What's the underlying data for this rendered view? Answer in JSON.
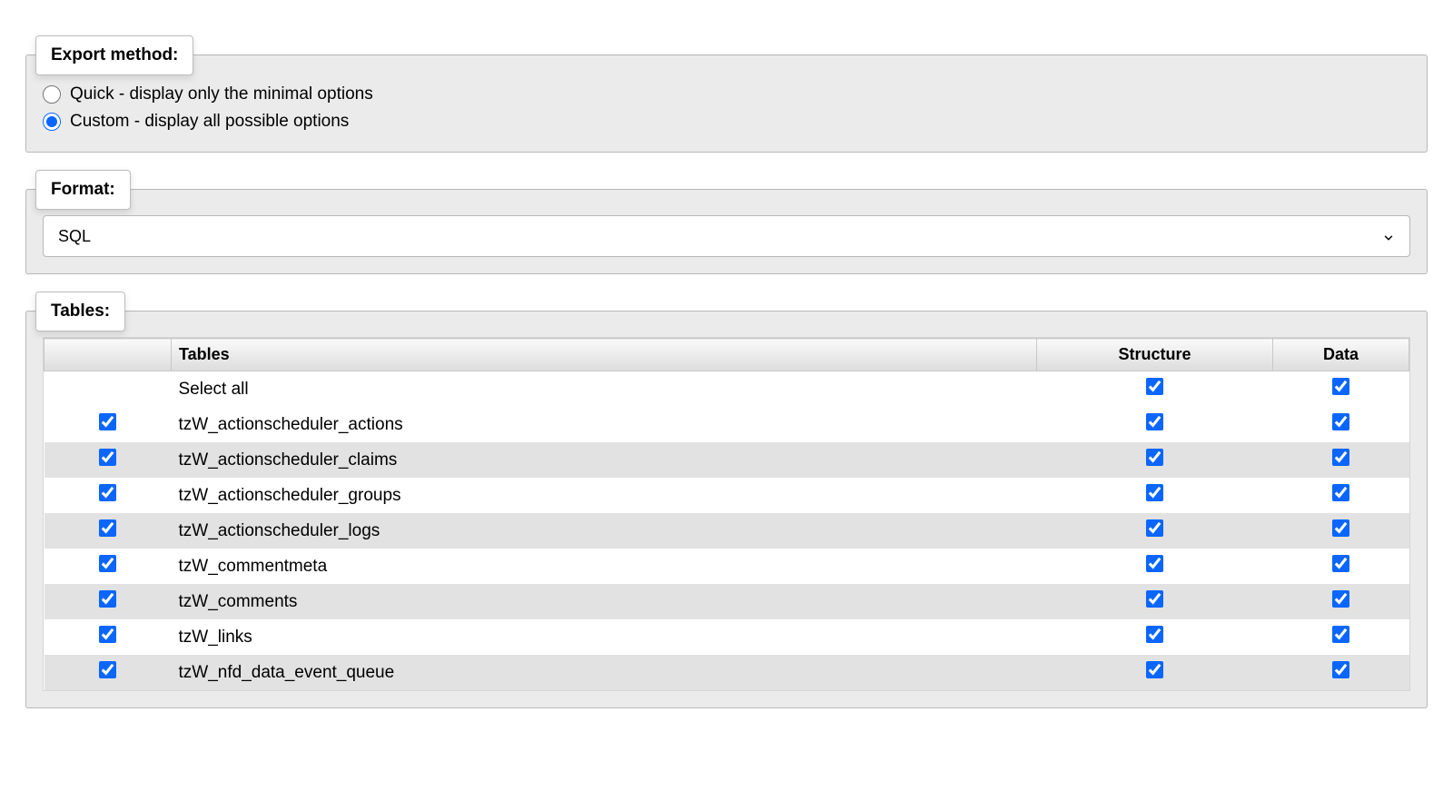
{
  "export_method": {
    "legend": "Export method:",
    "quick_label": "Quick - display only the minimal options",
    "custom_label": "Custom - display all possible options",
    "selected": "custom"
  },
  "format": {
    "legend": "Format:",
    "selected": "SQL"
  },
  "tables": {
    "legend": "Tables:",
    "headers": {
      "tables": "Tables",
      "structure": "Structure",
      "data": "Data"
    },
    "select_all_row": {
      "label": "Select all",
      "structure": true,
      "data": true
    },
    "rows": [
      {
        "name": "tzW_actionscheduler_actions",
        "selected": true,
        "structure": true,
        "data": true
      },
      {
        "name": "tzW_actionscheduler_claims",
        "selected": true,
        "structure": true,
        "data": true
      },
      {
        "name": "tzW_actionscheduler_groups",
        "selected": true,
        "structure": true,
        "data": true
      },
      {
        "name": "tzW_actionscheduler_logs",
        "selected": true,
        "structure": true,
        "data": true
      },
      {
        "name": "tzW_commentmeta",
        "selected": true,
        "structure": true,
        "data": true
      },
      {
        "name": "tzW_comments",
        "selected": true,
        "structure": true,
        "data": true
      },
      {
        "name": "tzW_links",
        "selected": true,
        "structure": true,
        "data": true
      },
      {
        "name": "tzW_nfd_data_event_queue",
        "selected": true,
        "structure": true,
        "data": true
      }
    ]
  }
}
